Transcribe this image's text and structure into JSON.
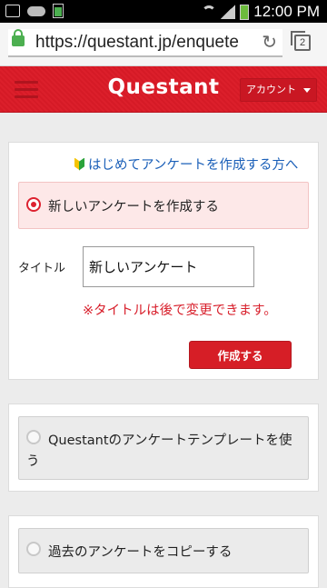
{
  "status_bar": {
    "time": "12:00 PM",
    "icons": [
      "hd-icon",
      "cloud-icon",
      "battery-small-icon",
      "wifi-icon",
      "signal-icon",
      "battery-icon"
    ]
  },
  "browser": {
    "url": "https://questant.jp/enquete",
    "tab_count": "2"
  },
  "header": {
    "logo": "Questant",
    "account_label": "アカウント"
  },
  "form": {
    "newbie_link": "はじめてアンケートを作成する方へ",
    "option_new_label": "新しいアンケートを作成する",
    "title_label": "タイトル",
    "title_value": "新しいアンケート",
    "warning": "※タイトルは後で変更できます。",
    "create_button": "作成する"
  },
  "template_option": {
    "label_line1": "Questantのアンケートテンプレートを使",
    "label_line2": "う"
  },
  "copy_option": {
    "label": "過去のアンケートをコピーする"
  },
  "colors": {
    "brand_red": "#dc1f2b",
    "link_blue": "#1a5fb8",
    "warning_red": "#d8202c",
    "selected_bg": "#fde8e8"
  }
}
